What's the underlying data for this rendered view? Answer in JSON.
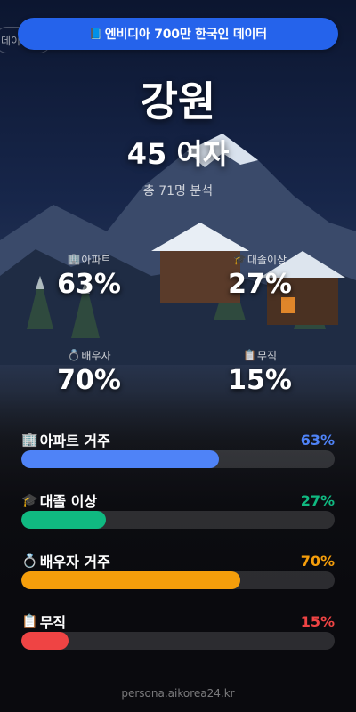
{
  "banner": {
    "flag_icon": "book-icon",
    "text": "엔비디아 700만 한국인 데이터"
  },
  "background_chip": "데이",
  "header": {
    "region": "강원",
    "persona": "45 여자",
    "sample_note": "총 71명 분석"
  },
  "stats": [
    {
      "icon": "building-icon",
      "glyph": "🏢",
      "label": "아파트",
      "value": "63%"
    },
    {
      "icon": "graduation-cap-icon",
      "glyph": "🎓",
      "label": "대졸이상",
      "value": "27%"
    },
    {
      "icon": "ring-icon",
      "glyph": "💍",
      "label": "배우자",
      "value": "70%"
    },
    {
      "icon": "clipboard-icon",
      "glyph": "📋",
      "label": "무직",
      "value": "15%"
    }
  ],
  "bars": [
    {
      "icon": "building-icon",
      "glyph": "🏢",
      "label": "아파트 거주",
      "value_text": "63%",
      "fraction": 0.63,
      "color": "#4f83f7"
    },
    {
      "icon": "graduation-cap-icon",
      "glyph": "🎓",
      "label": "대졸 이상",
      "value_text": "27%",
      "fraction": 0.27,
      "color": "#10b981"
    },
    {
      "icon": "ring-icon",
      "glyph": "💍",
      "label": "배우자 거주",
      "value_text": "70%",
      "fraction": 0.7,
      "color": "#f59e0b"
    },
    {
      "icon": "clipboard-icon",
      "glyph": "📋",
      "label": "무직",
      "value_text": "15%",
      "fraction": 0.15,
      "color": "#ef4444"
    }
  ],
  "footer": "persona.aikorea24.kr"
}
